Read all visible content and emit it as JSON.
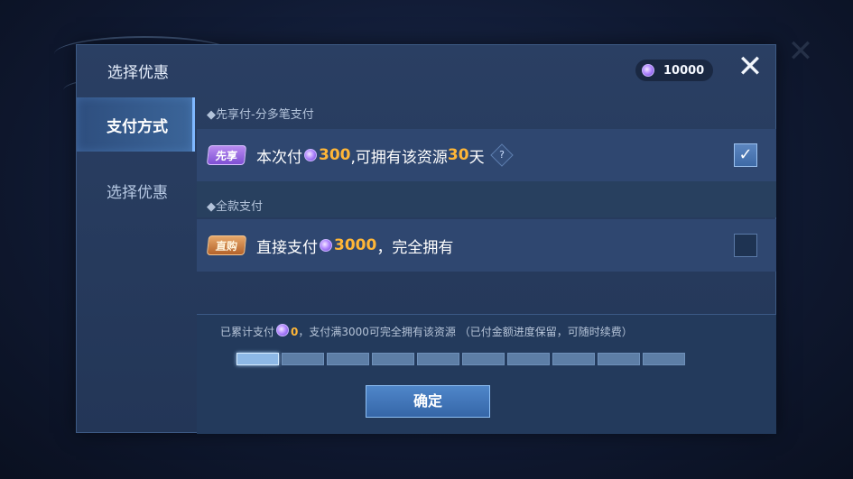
{
  "header": {
    "title": "选择优惠",
    "balance": "10000",
    "close_icon": "close-icon"
  },
  "sidebar": {
    "items": [
      {
        "label": "支付方式",
        "active": true
      },
      {
        "label": "选择优惠",
        "active": false
      }
    ]
  },
  "sections": [
    {
      "label": "◆先享付-分多笔支付",
      "option": {
        "badge": "先享",
        "text_a": "本次付",
        "amount": "300",
        "text_b": ",可拥有该资源",
        "days": "30",
        "text_c": "天",
        "help": "?",
        "checked": true
      }
    },
    {
      "label": "◆全款支付",
      "option": {
        "badge": "直购",
        "text_a": "直接支付",
        "amount": "3000",
        "text_b": "，完全拥有",
        "checked": false
      }
    }
  ],
  "progress": {
    "text_a": "已累计支付",
    "paid": "0",
    "text_b": "，支付满3000可完全拥有该资源 （已付金额进度保留，可随时续费）",
    "segments": 10,
    "current_segment": 1
  },
  "confirm_label": "确定",
  "colors": {
    "accent": "#ffb637",
    "panel": "#2a3f63",
    "button": "#4f86c9"
  }
}
